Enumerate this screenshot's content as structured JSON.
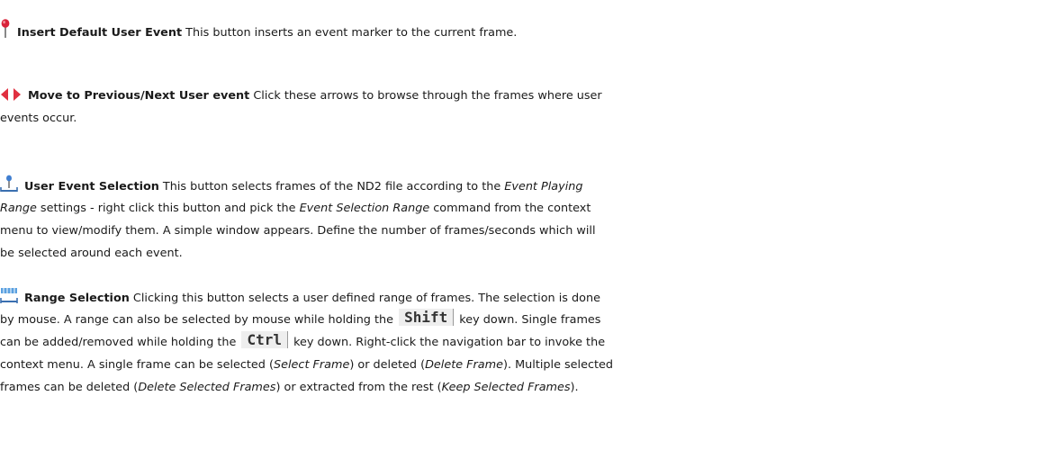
{
  "items": [
    {
      "icon": "pin-icon",
      "title": "Insert Default User Event",
      "text": " This button inserts an event marker to the current frame."
    },
    {
      "icon": "left-right-arrows-icon",
      "title": "Move to Previous/Next User event",
      "line1": " Click these arrows to browse through the frames where user",
      "line2": "events occur."
    },
    {
      "icon": "user-event-selection-icon",
      "title": "User Event Selection",
      "l1a": " This button selects frames of the ND2 file according to the ",
      "l1em": "Event Playing",
      "l2em": "Range",
      "l2a": " settings - right click this button and pick the ",
      "l2em2": "Event Selection Range",
      "l2b": " command from the context",
      "l3": "menu to view/modify them. A simple window appears. Define the number of frames/seconds which will",
      "l4": "be selected around each event."
    },
    {
      "icon": "range-selection-icon",
      "title": "Range Selection",
      "l1a": " Clicking this button selects a user defined range of frames. The selection is done",
      "l2a": "by mouse. A range can also be selected by mouse while holding the ",
      "key_shift": "Shift",
      "l2b": " key down. Single frames",
      "l3a": "can be added/removed while holding the ",
      "key_ctrl": "Ctrl",
      "l3b": " key down. Right-click the navigation bar to invoke the",
      "l4a": "context menu. A single frame can be selected (",
      "l4em1": "Select Frame",
      "l4b": ") or deleted (",
      "l4em2": "Delete Frame",
      "l4c": "). Multiple selected",
      "l5a": "frames can be deleted (",
      "l5em1": "Delete Selected Frames",
      "l5b": ") or extracted from the rest (",
      "l5em2": "Keep Selected Frames",
      "l5c": ")."
    }
  ]
}
